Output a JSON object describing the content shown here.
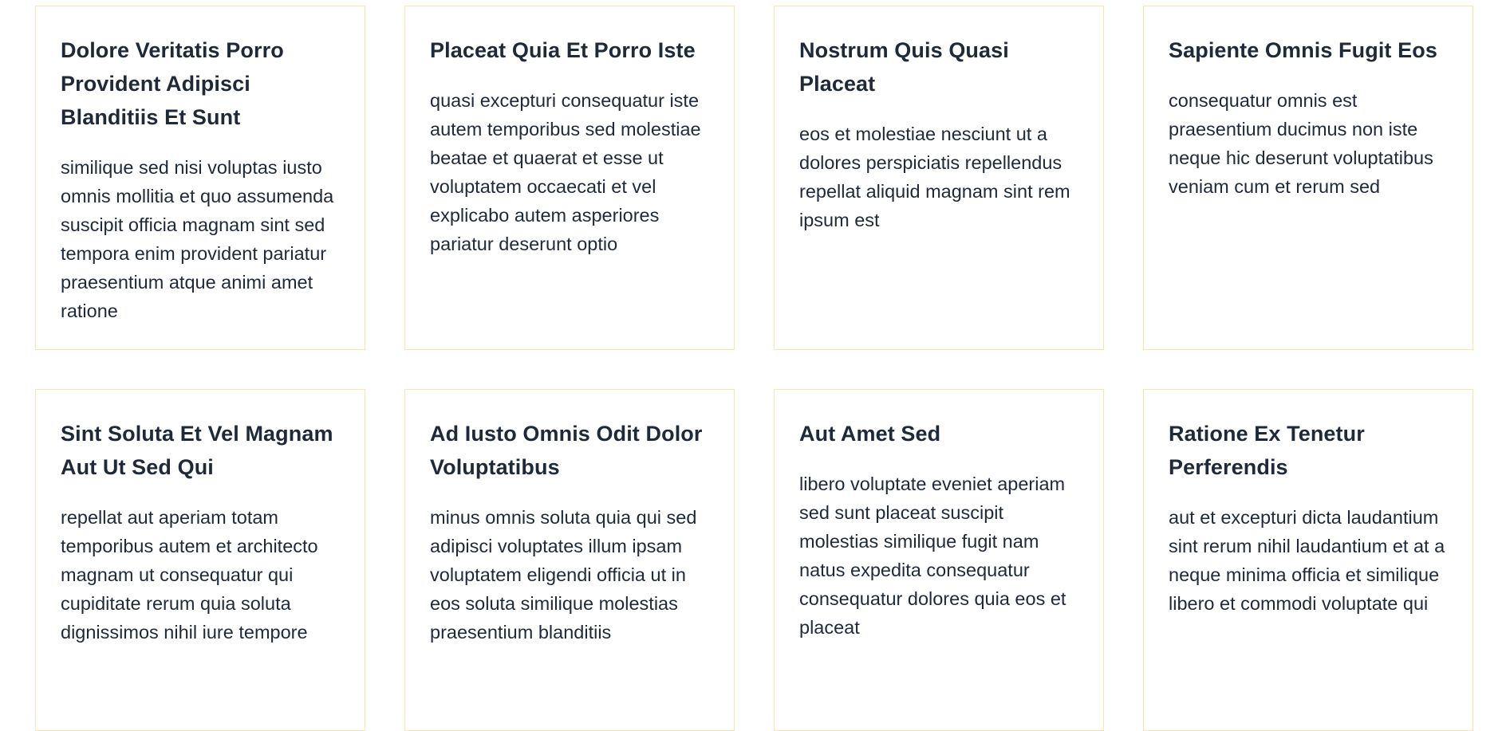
{
  "cards": [
    {
      "title": "Dolore Veritatis Porro Provident Adipisci Blanditiis Et Sunt",
      "body": "similique sed nisi voluptas iusto omnis mollitia et quo assumenda suscipit officia magnam sint sed tempora enim provident pariatur praesentium atque animi amet ratione"
    },
    {
      "title": "Placeat Quia Et Porro Iste",
      "body": "quasi excepturi consequatur iste autem temporibus sed molestiae beatae et quaerat et esse ut voluptatem occaecati et vel explicabo autem asperiores pariatur deserunt optio"
    },
    {
      "title": "Nostrum Quis Quasi Placeat",
      "body": "eos et molestiae nesciunt ut a dolores perspiciatis repellendus repellat aliquid magnam sint rem ipsum est"
    },
    {
      "title": "Sapiente Omnis Fugit Eos",
      "body": "consequatur omnis est praesentium ducimus non iste neque hic deserunt voluptatibus veniam cum et rerum sed"
    },
    {
      "title": "Sint Soluta Et Vel Magnam Aut Ut Sed Qui",
      "body": "repellat aut aperiam totam temporibus autem et architecto magnam ut consequatur qui cupiditate rerum quia soluta dignissimos nihil iure tempore"
    },
    {
      "title": "Ad Iusto Omnis Odit Dolor Voluptatibus",
      "body": "minus omnis soluta quia qui sed adipisci voluptates illum ipsam voluptatem eligendi officia ut in eos soluta similique molestias praesentium blanditiis"
    },
    {
      "title": "Aut Amet Sed",
      "body": "libero voluptate eveniet aperiam sed sunt placeat suscipit molestias similique fugit nam natus expedita consequatur consequatur dolores quia eos et placeat"
    },
    {
      "title": "Ratione Ex Tenetur Perferendis",
      "body": "aut et excepturi dicta laudantium sint rerum nihil laudantium et at a neque minima officia et similique libero et commodi voluptate qui"
    }
  ],
  "colors": {
    "card_border": "#fde3b5",
    "title_text": "#1f2937",
    "body_text": "#1f2937",
    "background": "#ffffff"
  }
}
